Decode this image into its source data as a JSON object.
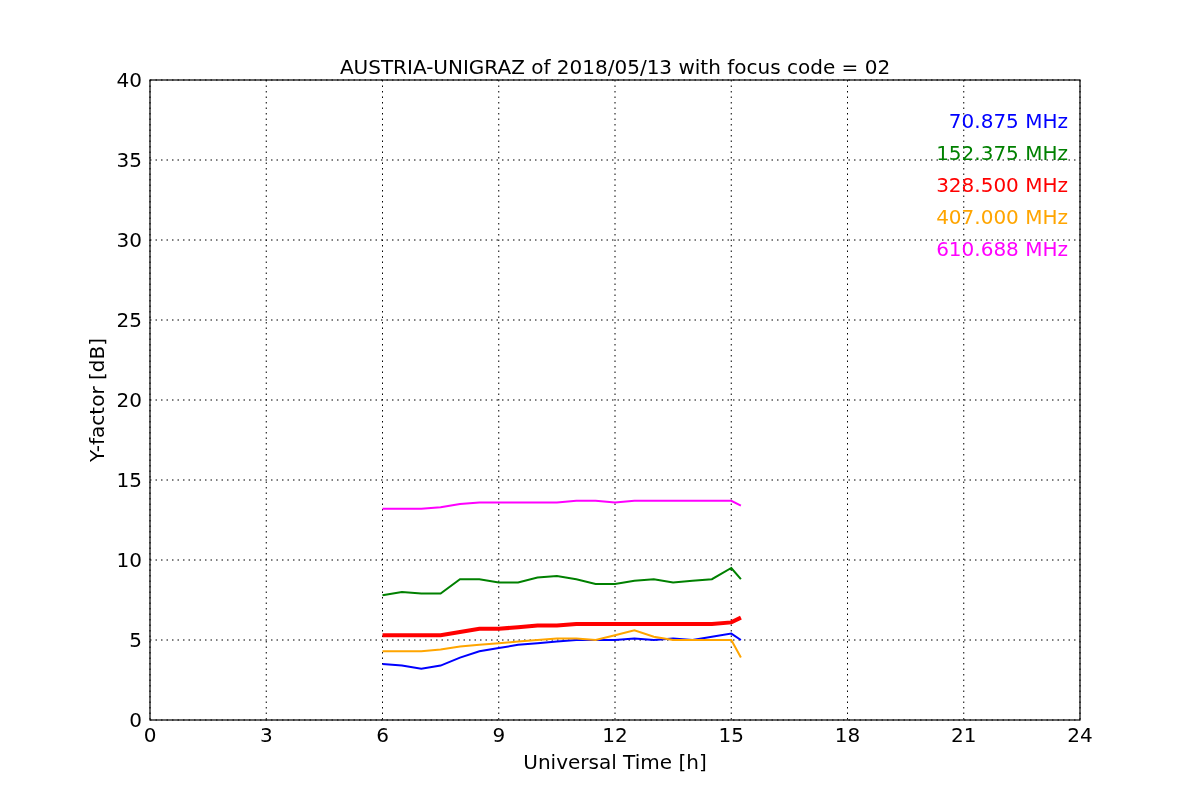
{
  "chart_data": {
    "type": "line",
    "title": "AUSTRIA-UNIGRAZ of 2018/05/13 with focus code = 02",
    "xlabel": "Universal Time [h]",
    "ylabel": "Y-factor [dB]",
    "xlim": [
      0,
      24
    ],
    "ylim": [
      0,
      40
    ],
    "grid": true,
    "xticks": [
      0,
      3,
      6,
      9,
      12,
      15,
      18,
      21,
      24
    ],
    "yticks": [
      0,
      5,
      10,
      15,
      20,
      25,
      30,
      35,
      40
    ],
    "x": [
      6,
      6.5,
      7,
      7.5,
      8,
      8.5,
      9,
      9.5,
      10,
      10.5,
      11,
      11.5,
      12,
      12.5,
      13,
      13.5,
      14,
      14.5,
      15,
      15.25
    ],
    "series": [
      {
        "name": "70.875 MHz",
        "color": "#0000ff",
        "values": [
          3.5,
          3.4,
          3.2,
          3.4,
          3.9,
          4.3,
          4.5,
          4.7,
          4.8,
          4.9,
          5.0,
          5.0,
          5.0,
          5.1,
          5.0,
          5.1,
          5.0,
          5.2,
          5.4,
          5.0
        ]
      },
      {
        "name": "152.375 MHz",
        "color": "#008000",
        "values": [
          7.8,
          8.0,
          7.9,
          7.9,
          8.8,
          8.8,
          8.6,
          8.6,
          8.9,
          9.0,
          8.8,
          8.5,
          8.5,
          8.7,
          8.8,
          8.6,
          8.7,
          8.8,
          9.5,
          8.8
        ]
      },
      {
        "name": "328.500 MHz",
        "color": "#ff0000",
        "values": [
          5.3,
          5.3,
          5.3,
          5.3,
          5.5,
          5.7,
          5.7,
          5.8,
          5.9,
          5.9,
          6.0,
          6.0,
          6.0,
          6.0,
          6.0,
          6.0,
          6.0,
          6.0,
          6.1,
          6.4
        ]
      },
      {
        "name": "407.000 MHz",
        "color": "#ffa500",
        "values": [
          4.3,
          4.3,
          4.3,
          4.4,
          4.6,
          4.7,
          4.8,
          4.9,
          5.0,
          5.1,
          5.1,
          5.0,
          5.3,
          5.6,
          5.2,
          5.0,
          5.0,
          5.0,
          5.0,
          3.9
        ]
      },
      {
        "name": "610.688 MHz",
        "color": "#ff00ff",
        "values": [
          13.2,
          13.2,
          13.2,
          13.3,
          13.5,
          13.6,
          13.6,
          13.6,
          13.6,
          13.6,
          13.7,
          13.7,
          13.6,
          13.7,
          13.7,
          13.7,
          13.7,
          13.7,
          13.7,
          13.4
        ]
      }
    ]
  }
}
